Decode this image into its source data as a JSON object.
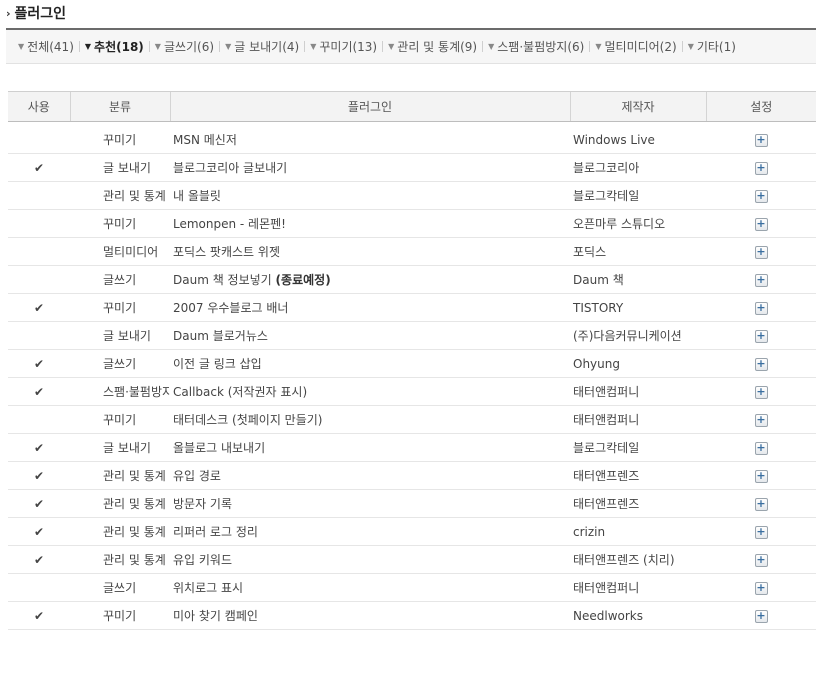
{
  "page": {
    "title": "플러그인",
    "title_icon": "chevron-right-icon"
  },
  "filters": [
    {
      "label": "전체(41)",
      "active": false
    },
    {
      "label": "추천(18)",
      "active": true
    },
    {
      "label": "글쓰기(6)",
      "active": false
    },
    {
      "label": "글 보내기(4)",
      "active": false
    },
    {
      "label": "꾸미기(13)",
      "active": false
    },
    {
      "label": "관리 및 통계(9)",
      "active": false
    },
    {
      "label": "스팸·불펌방지(6)",
      "active": false
    },
    {
      "label": "멀티미디어(2)",
      "active": false
    },
    {
      "label": "기타(1)",
      "active": false
    }
  ],
  "table": {
    "headers": {
      "use": "사용",
      "category": "분류",
      "plugin": "플러그인",
      "maker": "제작자",
      "setting": "설정"
    },
    "check_mark": "✔",
    "plus_symbol": "+",
    "rows": [
      {
        "enabled": false,
        "category": "꾸미기",
        "name": "MSN 메신저",
        "note": "",
        "maker": "Windows Live"
      },
      {
        "enabled": true,
        "category": "글 보내기",
        "name": "블로그코리아 글보내기",
        "note": "",
        "maker": "블로그코리아"
      },
      {
        "enabled": false,
        "category": "관리 및 통계",
        "name": "내 올블릿",
        "note": "",
        "maker": "블로그칵테일"
      },
      {
        "enabled": false,
        "category": "꾸미기",
        "name": "Lemonpen - 레몬펜!",
        "note": "",
        "maker": "오픈마루 스튜디오"
      },
      {
        "enabled": false,
        "category": "멀티미디어",
        "name": "포딕스 팟캐스트 위젯",
        "note": "",
        "maker": "포딕스"
      },
      {
        "enabled": false,
        "category": "글쓰기",
        "name": "Daum 책 정보넣기 ",
        "note": "(종료예정)",
        "maker": "Daum 책"
      },
      {
        "enabled": true,
        "category": "꾸미기",
        "name": "2007 우수블로그 배너",
        "note": "",
        "maker": "TISTORY"
      },
      {
        "enabled": false,
        "category": "글 보내기",
        "name": "Daum 블로거뉴스",
        "note": "",
        "maker": "(주)다음커뮤니케이션"
      },
      {
        "enabled": true,
        "category": "글쓰기",
        "name": "이전 글 링크 삽입",
        "note": "",
        "maker": "Ohyung"
      },
      {
        "enabled": true,
        "category": "스팸·불펌방지",
        "name": "Callback (저작권자 표시)",
        "note": "",
        "maker": "태터앤컴퍼니"
      },
      {
        "enabled": false,
        "category": "꾸미기",
        "name": "태터데스크 (첫페이지 만들기)",
        "note": "",
        "maker": "태터앤컴퍼니"
      },
      {
        "enabled": true,
        "category": "글 보내기",
        "name": "올블로그 내보내기",
        "note": "",
        "maker": "블로그칵테일"
      },
      {
        "enabled": true,
        "category": "관리 및 통계",
        "name": "유입 경로",
        "note": "",
        "maker": "태터앤프렌즈"
      },
      {
        "enabled": true,
        "category": "관리 및 통계",
        "name": "방문자 기록",
        "note": "",
        "maker": "태터앤프렌즈"
      },
      {
        "enabled": true,
        "category": "관리 및 통계",
        "name": "리퍼러 로그 정리",
        "note": "",
        "maker": "crizin"
      },
      {
        "enabled": true,
        "category": "관리 및 통계",
        "name": "유입 키워드",
        "note": "",
        "maker": "태터앤프렌즈 (치리)"
      },
      {
        "enabled": false,
        "category": "글쓰기",
        "name": "위치로그 표시",
        "note": "",
        "maker": "태터앤컴퍼니"
      },
      {
        "enabled": true,
        "category": "꾸미기",
        "name": "미아 찾기 캠페인",
        "note": "",
        "maker": "Needlworks"
      }
    ]
  }
}
